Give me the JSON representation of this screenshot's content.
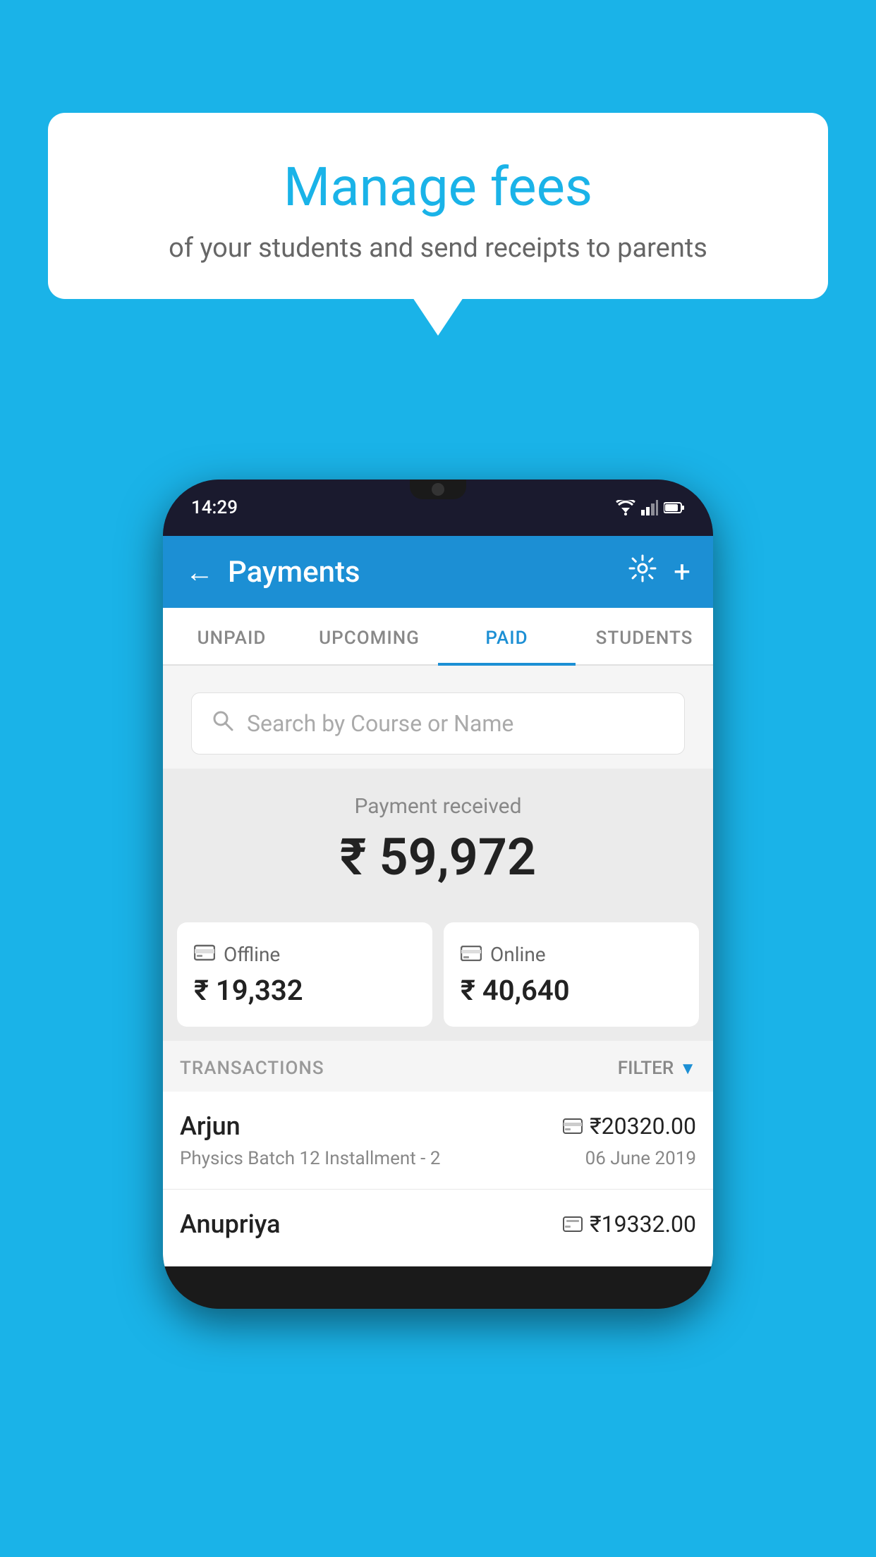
{
  "page": {
    "background_color": "#1ab3e8"
  },
  "bubble": {
    "title": "Manage fees",
    "subtitle": "of your students and send receipts to parents"
  },
  "phone": {
    "status_bar": {
      "time": "14:29"
    },
    "header": {
      "title": "Payments",
      "back_label": "←",
      "settings_label": "⚙",
      "add_label": "+"
    },
    "tabs": [
      {
        "id": "unpaid",
        "label": "UNPAID",
        "active": false
      },
      {
        "id": "upcoming",
        "label": "UPCOMING",
        "active": false
      },
      {
        "id": "paid",
        "label": "PAID",
        "active": true
      },
      {
        "id": "students",
        "label": "STUDENTS",
        "active": false
      }
    ],
    "search": {
      "placeholder": "Search by Course or Name"
    },
    "payment_received": {
      "label": "Payment received",
      "amount": "₹ 59,972"
    },
    "payment_modes": [
      {
        "id": "offline",
        "label": "Offline",
        "amount": "₹ 19,332",
        "icon": "₹"
      },
      {
        "id": "online",
        "label": "Online",
        "amount": "₹ 40,640",
        "icon": "💳"
      }
    ],
    "transactions": {
      "label": "TRANSACTIONS",
      "filter_label": "FILTER"
    },
    "transaction_list": [
      {
        "student": "Arjun",
        "course": "Physics Batch 12 Installment - 2",
        "amount": "₹20320.00",
        "date": "06 June 2019",
        "payment_type": "online"
      },
      {
        "student": "Anupriya",
        "course": "",
        "amount": "₹19332.00",
        "date": "",
        "payment_type": "offline"
      }
    ]
  }
}
